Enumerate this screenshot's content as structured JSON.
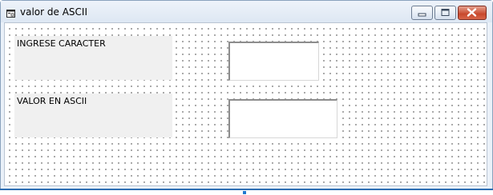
{
  "window": {
    "title": "valor de ASCII"
  },
  "icons": {
    "app": "form-icon",
    "minimize": "minimize-icon",
    "maximize": "maximize-icon",
    "close": "close-icon"
  },
  "form": {
    "label1": "INGRESE CARACTER",
    "label2": "VALOR EN ASCII",
    "input1_value": "",
    "input2_value": ""
  },
  "colors": {
    "accent": "#2f6fb3",
    "close_button": "#c8482c",
    "label_background": "#f0f0f0"
  }
}
